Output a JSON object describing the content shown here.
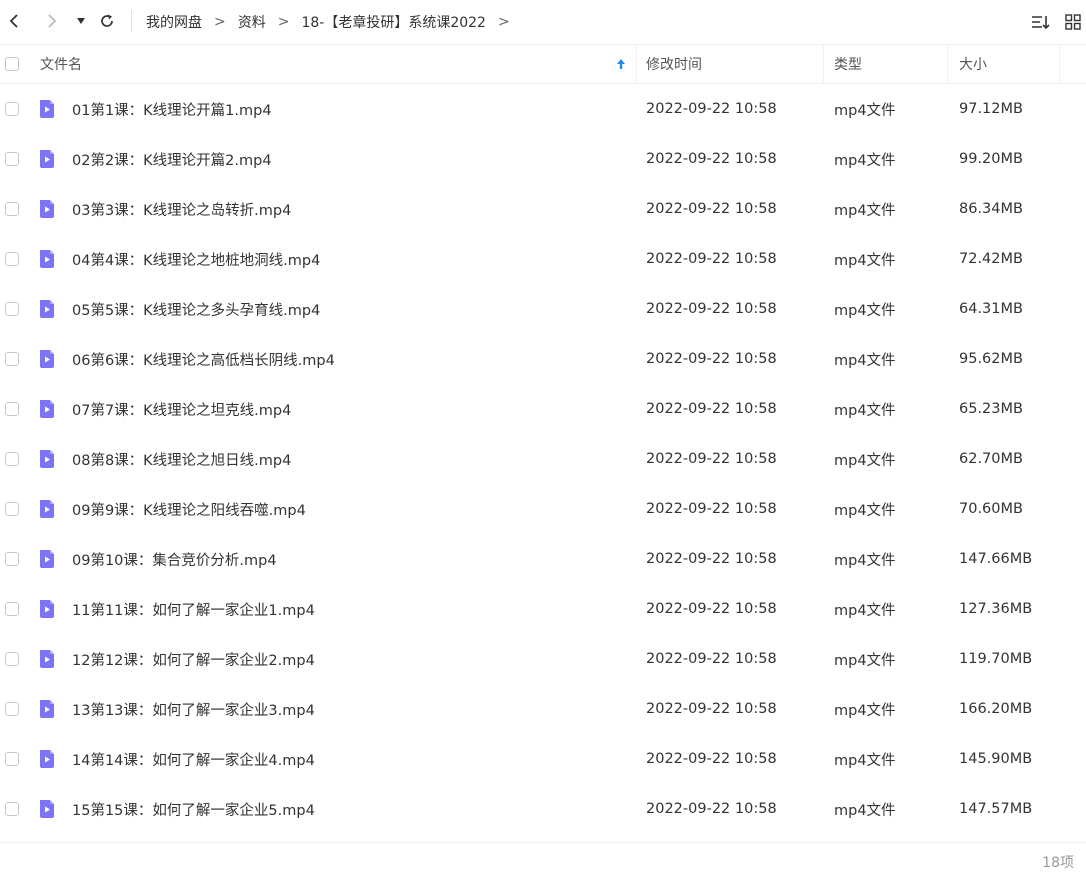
{
  "toolbar": {
    "back_icon": "chevron-left-icon",
    "forward_icon": "chevron-right-icon",
    "history_icon": "caret-down-icon",
    "refresh_icon": "refresh-icon",
    "sort_icon": "sort-list-icon",
    "view_icon": "grid-view-icon"
  },
  "breadcrumb": {
    "items": [
      "我的网盘",
      "资料",
      "18-【老章投研】系统课2022"
    ],
    "separator": ">"
  },
  "table": {
    "columns": {
      "name": "文件名",
      "modified": "修改时间",
      "type": "类型",
      "size": "大小"
    },
    "sort_indicator_icon": "arrow-up-icon",
    "accent_color": "#1a8cff",
    "file_icon_color": "#7b74f5",
    "rows": [
      {
        "name": "01第1课：K线理论开篇1.mp4",
        "modified": "2022-09-22 10:58",
        "type": "mp4文件",
        "size": "97.12MB"
      },
      {
        "name": "02第2课：K线理论开篇2.mp4",
        "modified": "2022-09-22 10:58",
        "type": "mp4文件",
        "size": "99.20MB"
      },
      {
        "name": "03第3课：K线理论之岛转折.mp4",
        "modified": "2022-09-22 10:58",
        "type": "mp4文件",
        "size": "86.34MB"
      },
      {
        "name": "04第4课：K线理论之地桩地洞线.mp4",
        "modified": "2022-09-22 10:58",
        "type": "mp4文件",
        "size": "72.42MB"
      },
      {
        "name": "05第5课：K线理论之多头孕育线.mp4",
        "modified": "2022-09-22 10:58",
        "type": "mp4文件",
        "size": "64.31MB"
      },
      {
        "name": "06第6课：K线理论之高低档长阴线.mp4",
        "modified": "2022-09-22 10:58",
        "type": "mp4文件",
        "size": "95.62MB"
      },
      {
        "name": "07第7课：K线理论之坦克线.mp4",
        "modified": "2022-09-22 10:58",
        "type": "mp4文件",
        "size": "65.23MB"
      },
      {
        "name": "08第8课：K线理论之旭日线.mp4",
        "modified": "2022-09-22 10:58",
        "type": "mp4文件",
        "size": "62.70MB"
      },
      {
        "name": "09第9课：K线理论之阳线吞噬.mp4",
        "modified": "2022-09-22 10:58",
        "type": "mp4文件",
        "size": "70.60MB"
      },
      {
        "name": "09第10课：集合竞价分析.mp4",
        "modified": "2022-09-22 10:58",
        "type": "mp4文件",
        "size": "147.66MB"
      },
      {
        "name": "11第11课：如何了解一家企业1.mp4",
        "modified": "2022-09-22 10:58",
        "type": "mp4文件",
        "size": "127.36MB"
      },
      {
        "name": "12第12课：如何了解一家企业2.mp4",
        "modified": "2022-09-22 10:58",
        "type": "mp4文件",
        "size": "119.70MB"
      },
      {
        "name": "13第13课：如何了解一家企业3.mp4",
        "modified": "2022-09-22 10:58",
        "type": "mp4文件",
        "size": "166.20MB"
      },
      {
        "name": "14第14课：如何了解一家企业4.mp4",
        "modified": "2022-09-22 10:58",
        "type": "mp4文件",
        "size": "145.90MB"
      },
      {
        "name": "15第15课：如何了解一家企业5.mp4",
        "modified": "2022-09-22 10:58",
        "type": "mp4文件",
        "size": "147.57MB"
      }
    ]
  },
  "footer": {
    "count": "18项"
  }
}
